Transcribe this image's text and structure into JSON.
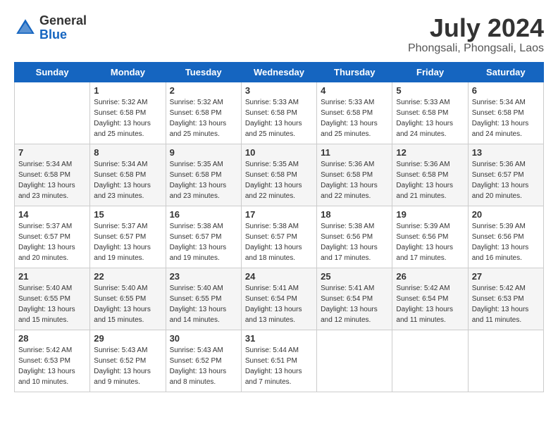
{
  "header": {
    "logo_general": "General",
    "logo_blue": "Blue",
    "month_year": "July 2024",
    "location": "Phongsali, Phongsali, Laos"
  },
  "days_of_week": [
    "Sunday",
    "Monday",
    "Tuesday",
    "Wednesday",
    "Thursday",
    "Friday",
    "Saturday"
  ],
  "weeks": [
    [
      {
        "day": "",
        "sunrise": "",
        "sunset": "",
        "daylight": ""
      },
      {
        "day": "1",
        "sunrise": "Sunrise: 5:32 AM",
        "sunset": "Sunset: 6:58 PM",
        "daylight": "Daylight: 13 hours and 25 minutes."
      },
      {
        "day": "2",
        "sunrise": "Sunrise: 5:32 AM",
        "sunset": "Sunset: 6:58 PM",
        "daylight": "Daylight: 13 hours and 25 minutes."
      },
      {
        "day": "3",
        "sunrise": "Sunrise: 5:33 AM",
        "sunset": "Sunset: 6:58 PM",
        "daylight": "Daylight: 13 hours and 25 minutes."
      },
      {
        "day": "4",
        "sunrise": "Sunrise: 5:33 AM",
        "sunset": "Sunset: 6:58 PM",
        "daylight": "Daylight: 13 hours and 25 minutes."
      },
      {
        "day": "5",
        "sunrise": "Sunrise: 5:33 AM",
        "sunset": "Sunset: 6:58 PM",
        "daylight": "Daylight: 13 hours and 24 minutes."
      },
      {
        "day": "6",
        "sunrise": "Sunrise: 5:34 AM",
        "sunset": "Sunset: 6:58 PM",
        "daylight": "Daylight: 13 hours and 24 minutes."
      }
    ],
    [
      {
        "day": "7",
        "sunrise": "Sunrise: 5:34 AM",
        "sunset": "Sunset: 6:58 PM",
        "daylight": "Daylight: 13 hours and 23 minutes."
      },
      {
        "day": "8",
        "sunrise": "Sunrise: 5:34 AM",
        "sunset": "Sunset: 6:58 PM",
        "daylight": "Daylight: 13 hours and 23 minutes."
      },
      {
        "day": "9",
        "sunrise": "Sunrise: 5:35 AM",
        "sunset": "Sunset: 6:58 PM",
        "daylight": "Daylight: 13 hours and 23 minutes."
      },
      {
        "day": "10",
        "sunrise": "Sunrise: 5:35 AM",
        "sunset": "Sunset: 6:58 PM",
        "daylight": "Daylight: 13 hours and 22 minutes."
      },
      {
        "day": "11",
        "sunrise": "Sunrise: 5:36 AM",
        "sunset": "Sunset: 6:58 PM",
        "daylight": "Daylight: 13 hours and 22 minutes."
      },
      {
        "day": "12",
        "sunrise": "Sunrise: 5:36 AM",
        "sunset": "Sunset: 6:58 PM",
        "daylight": "Daylight: 13 hours and 21 minutes."
      },
      {
        "day": "13",
        "sunrise": "Sunrise: 5:36 AM",
        "sunset": "Sunset: 6:57 PM",
        "daylight": "Daylight: 13 hours and 20 minutes."
      }
    ],
    [
      {
        "day": "14",
        "sunrise": "Sunrise: 5:37 AM",
        "sunset": "Sunset: 6:57 PM",
        "daylight": "Daylight: 13 hours and 20 minutes."
      },
      {
        "day": "15",
        "sunrise": "Sunrise: 5:37 AM",
        "sunset": "Sunset: 6:57 PM",
        "daylight": "Daylight: 13 hours and 19 minutes."
      },
      {
        "day": "16",
        "sunrise": "Sunrise: 5:38 AM",
        "sunset": "Sunset: 6:57 PM",
        "daylight": "Daylight: 13 hours and 19 minutes."
      },
      {
        "day": "17",
        "sunrise": "Sunrise: 5:38 AM",
        "sunset": "Sunset: 6:57 PM",
        "daylight": "Daylight: 13 hours and 18 minutes."
      },
      {
        "day": "18",
        "sunrise": "Sunrise: 5:38 AM",
        "sunset": "Sunset: 6:56 PM",
        "daylight": "Daylight: 13 hours and 17 minutes."
      },
      {
        "day": "19",
        "sunrise": "Sunrise: 5:39 AM",
        "sunset": "Sunset: 6:56 PM",
        "daylight": "Daylight: 13 hours and 17 minutes."
      },
      {
        "day": "20",
        "sunrise": "Sunrise: 5:39 AM",
        "sunset": "Sunset: 6:56 PM",
        "daylight": "Daylight: 13 hours and 16 minutes."
      }
    ],
    [
      {
        "day": "21",
        "sunrise": "Sunrise: 5:40 AM",
        "sunset": "Sunset: 6:55 PM",
        "daylight": "Daylight: 13 hours and 15 minutes."
      },
      {
        "day": "22",
        "sunrise": "Sunrise: 5:40 AM",
        "sunset": "Sunset: 6:55 PM",
        "daylight": "Daylight: 13 hours and 15 minutes."
      },
      {
        "day": "23",
        "sunrise": "Sunrise: 5:40 AM",
        "sunset": "Sunset: 6:55 PM",
        "daylight": "Daylight: 13 hours and 14 minutes."
      },
      {
        "day": "24",
        "sunrise": "Sunrise: 5:41 AM",
        "sunset": "Sunset: 6:54 PM",
        "daylight": "Daylight: 13 hours and 13 minutes."
      },
      {
        "day": "25",
        "sunrise": "Sunrise: 5:41 AM",
        "sunset": "Sunset: 6:54 PM",
        "daylight": "Daylight: 13 hours and 12 minutes."
      },
      {
        "day": "26",
        "sunrise": "Sunrise: 5:42 AM",
        "sunset": "Sunset: 6:54 PM",
        "daylight": "Daylight: 13 hours and 11 minutes."
      },
      {
        "day": "27",
        "sunrise": "Sunrise: 5:42 AM",
        "sunset": "Sunset: 6:53 PM",
        "daylight": "Daylight: 13 hours and 11 minutes."
      }
    ],
    [
      {
        "day": "28",
        "sunrise": "Sunrise: 5:42 AM",
        "sunset": "Sunset: 6:53 PM",
        "daylight": "Daylight: 13 hours and 10 minutes."
      },
      {
        "day": "29",
        "sunrise": "Sunrise: 5:43 AM",
        "sunset": "Sunset: 6:52 PM",
        "daylight": "Daylight: 13 hours and 9 minutes."
      },
      {
        "day": "30",
        "sunrise": "Sunrise: 5:43 AM",
        "sunset": "Sunset: 6:52 PM",
        "daylight": "Daylight: 13 hours and 8 minutes."
      },
      {
        "day": "31",
        "sunrise": "Sunrise: 5:44 AM",
        "sunset": "Sunset: 6:51 PM",
        "daylight": "Daylight: 13 hours and 7 minutes."
      },
      {
        "day": "",
        "sunrise": "",
        "sunset": "",
        "daylight": ""
      },
      {
        "day": "",
        "sunrise": "",
        "sunset": "",
        "daylight": ""
      },
      {
        "day": "",
        "sunrise": "",
        "sunset": "",
        "daylight": ""
      }
    ]
  ]
}
